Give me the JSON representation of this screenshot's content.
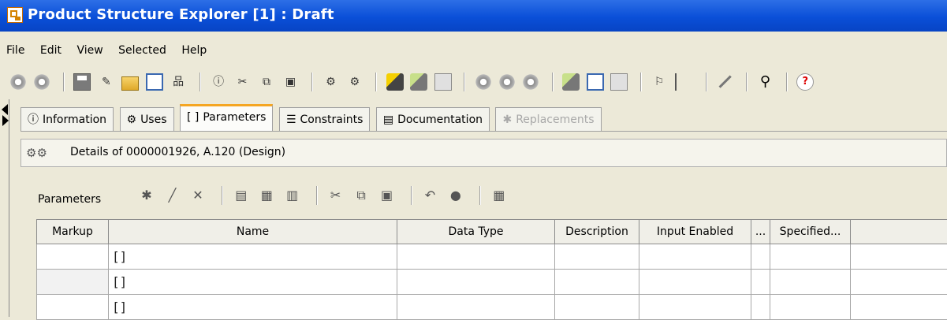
{
  "window": {
    "title": "Product Structure Explorer [1] : Draft"
  },
  "menu": [
    "File",
    "Edit",
    "View",
    "Selected",
    "Help"
  ],
  "toolbar": {
    "help_glyph": "?"
  },
  "tabs": [
    {
      "label": "Information",
      "icon": "ⓘ"
    },
    {
      "label": "Uses",
      "icon": "⚙"
    },
    {
      "label": "Parameters",
      "icon": "[ ]"
    },
    {
      "label": "Constraints",
      "icon": "☰"
    },
    {
      "label": "Documentation",
      "icon": "▤"
    },
    {
      "label": "Replacements",
      "icon": "✱"
    }
  ],
  "details": {
    "text": "Details of 0000001926, A.120 (Design)"
  },
  "parameters": {
    "label": "Parameters",
    "columns": [
      "Markup",
      "Name",
      "Data Type",
      "Description",
      "Input Enabled",
      "...",
      "Specified...",
      ""
    ],
    "rows": [
      {
        "name": "[]"
      },
      {
        "name": "[]"
      },
      {
        "name": "[]"
      }
    ]
  }
}
